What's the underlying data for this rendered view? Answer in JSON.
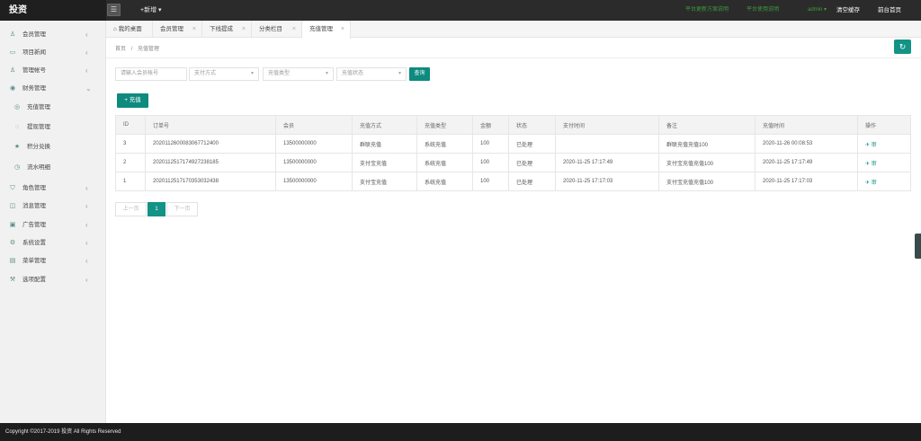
{
  "app": {
    "logo": "投资",
    "new_menu": "+新增 ▾",
    "menu_icon": "menu-icon"
  },
  "topbar": {
    "link1": "平台更新方案说明",
    "link2": "平台使用说明",
    "user": "admin ▾",
    "clear_cache": "清空缓存",
    "home_page": "前台首页"
  },
  "sidebar": {
    "items": [
      {
        "label": "会员管理",
        "icon": "user-icon",
        "chevron": "‹"
      },
      {
        "label": "项目新闻",
        "icon": "news-icon",
        "chevron": "‹"
      },
      {
        "label": "管理帐号",
        "icon": "admin-icon",
        "chevron": "‹"
      },
      {
        "label": "财务管理",
        "icon": "finance-icon",
        "chevron": "⌄"
      },
      {
        "label": "充值管理",
        "icon": "recharge-icon",
        "chevron": ""
      },
      {
        "label": "提现管理",
        "icon": "withdraw-icon",
        "chevron": ""
      },
      {
        "label": "积分兑换",
        "icon": "star-icon",
        "chevron": ""
      },
      {
        "label": "流水明细",
        "icon": "clock-icon",
        "chevron": ""
      },
      {
        "label": "角色管理",
        "icon": "role-icon",
        "chevron": "‹"
      },
      {
        "label": "消息管理",
        "icon": "message-icon",
        "chevron": "‹"
      },
      {
        "label": "广告管理",
        "icon": "ad-icon",
        "chevron": "‹"
      },
      {
        "label": "系统设置",
        "icon": "settings-icon",
        "chevron": "‹"
      },
      {
        "label": "菜单管理",
        "icon": "menu-list-icon",
        "chevron": "‹"
      },
      {
        "label": "选项配置",
        "icon": "options-icon",
        "chevron": "‹"
      }
    ]
  },
  "tabs": [
    {
      "label": "我的桌面",
      "icon": "home-icon"
    },
    {
      "label": "会员管理",
      "close": "×"
    },
    {
      "label": "下线提成",
      "close": "×"
    },
    {
      "label": "分类栏目",
      "close": "×"
    },
    {
      "label": "充值管理",
      "close": "×"
    }
  ],
  "breadcrumb": {
    "home": "首页",
    "sep": "/",
    "current": "充值管理"
  },
  "filters": {
    "account_placeholder": "请输入会员帐号",
    "pay_method": "支付方式",
    "recharge_type": "充值类型",
    "recharge_status": "充值状态",
    "dropdown_arrow": "▾",
    "query": "查询"
  },
  "add_button": "+ 充值",
  "table": {
    "headers": [
      "ID",
      "订单号",
      "会员",
      "充值方式",
      "充值类型",
      "金额",
      "状态",
      "支付时间",
      "备注",
      "充值时间",
      "操作"
    ],
    "rows": [
      [
        "3",
        "20201126000830677124​00",
        "13500000000",
        "群联充值",
        "系统充值",
        "100",
        "已处理",
        "",
        "群联充值充值100",
        "2020-11-26 00:08:53",
        "✈ 审"
      ],
      [
        "2",
        "20201125171749272381​85",
        "13500000000",
        "支付宝充值",
        "系统充值",
        "100",
        "已处理",
        "2020-11-25 17:17:49",
        "支付宝充值充值100",
        "2020-11-25 17:17:49",
        "✈ 审"
      ],
      [
        "1",
        "20201125171703530324​38",
        "13500000000",
        "支付宝充值",
        "系统充值",
        "100",
        "已处理",
        "2020-11-25 17:17:03",
        "支付宝充值充值100",
        "2020-11-25 17:17:03",
        "✈ 审"
      ]
    ]
  },
  "pager": {
    "prev": "上一页",
    "current": "1",
    "next": "下一页"
  },
  "footer": "Copyright ©2017-2019 投资 All Rights Reserved",
  "colors": {
    "accent": "#129385",
    "topbar": "#2b2b2b",
    "green_link": "#3e9b3e"
  }
}
